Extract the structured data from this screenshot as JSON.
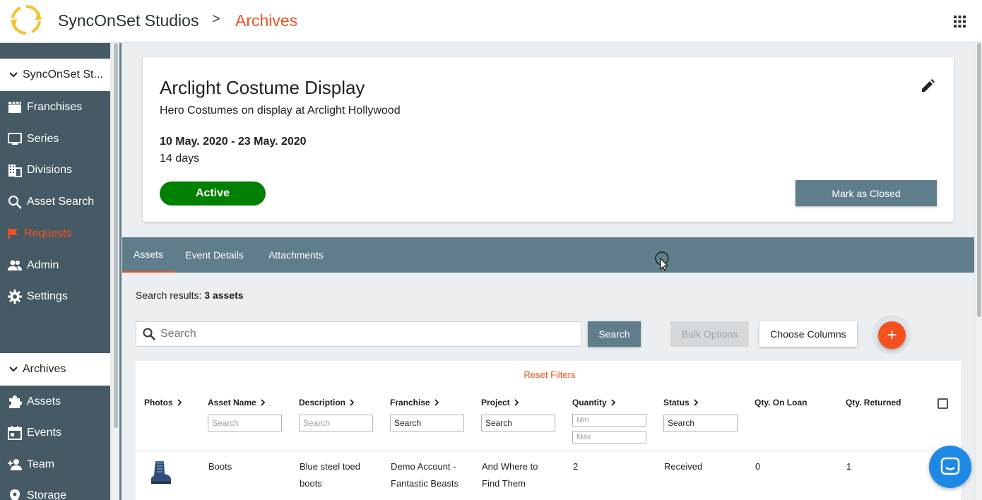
{
  "header": {
    "brand": "SyncOnSet Studios",
    "separator": ">",
    "current": "Archives",
    "apps_icon": "grid-apps-icon",
    "logo_icon": "sync-logo-icon"
  },
  "sidebar": {
    "section1": {
      "label": "SyncOnSet St...",
      "icon": "chevron-down-icon"
    },
    "items": [
      {
        "label": "Franchises",
        "icon": "clapperboard-icon"
      },
      {
        "label": "Series",
        "icon": "monitor-icon"
      },
      {
        "label": "Divisions",
        "icon": "building-icon"
      },
      {
        "label": "Asset Search",
        "icon": "search-icon"
      },
      {
        "label": "Requests",
        "icon": "flag-icon",
        "active": true
      },
      {
        "label": "Admin",
        "icon": "people-icon"
      },
      {
        "label": "Settings",
        "icon": "gear-icon"
      }
    ],
    "section2": {
      "label": "Archives",
      "icon": "chevron-down-icon"
    },
    "archive_items": [
      {
        "label": "Assets",
        "icon": "puzzle-icon"
      },
      {
        "label": "Events",
        "icon": "calendar-icon"
      },
      {
        "label": "Team",
        "icon": "add-person-icon"
      },
      {
        "label": "Storage",
        "icon": "location-pin-icon"
      }
    ]
  },
  "event": {
    "title": "Arclight Costume Display",
    "subtitle": "Hero Costumes on display at Arclight Hollywood",
    "dates": "10 May. 2020 - 23 May. 2020",
    "duration": "14 days",
    "status": "Active",
    "mark_closed": "Mark as Closed",
    "edit_icon": "pencil-icon"
  },
  "tabs": [
    {
      "label": "Assets",
      "active": true
    },
    {
      "label": "Event Details"
    },
    {
      "label": "Attachments"
    }
  ],
  "results": {
    "prefix": "Search results: ",
    "count": "3 assets"
  },
  "toolbar": {
    "search_placeholder": "Search",
    "search_button": "Search",
    "bulk_options": "Bulk Options",
    "choose_columns": "Choose Columns",
    "add_button": "+"
  },
  "table": {
    "reset_filters": "Reset Filters",
    "columns": [
      {
        "label": "Photos"
      },
      {
        "label": "Asset Name",
        "filter_placeholder": "Search"
      },
      {
        "label": "Description",
        "filter_placeholder": "Search"
      },
      {
        "label": "Franchise",
        "filter_value": "Search"
      },
      {
        "label": "Project",
        "filter_value": "Search"
      },
      {
        "label": "Quantity",
        "min_placeholder": "Min",
        "max_placeholder": "Max"
      },
      {
        "label": "Status",
        "filter_value": "Search"
      },
      {
        "label": "Qty. On Loan"
      },
      {
        "label": "Qty. Returned"
      }
    ],
    "rows": [
      {
        "photo": "boot-image",
        "asset_name": "Boots",
        "description_l1": "Blue steel toed",
        "description_l2": "boots",
        "franchise_l1": "Demo Account -",
        "franchise_l2": "Fantastic Beasts",
        "project_l1": "And Where to",
        "project_l2": "Find Them",
        "quantity": "2",
        "status": "Received",
        "on_loan": "0",
        "returned": "1"
      }
    ]
  },
  "chat_icon": "chat-bubble-icon"
}
